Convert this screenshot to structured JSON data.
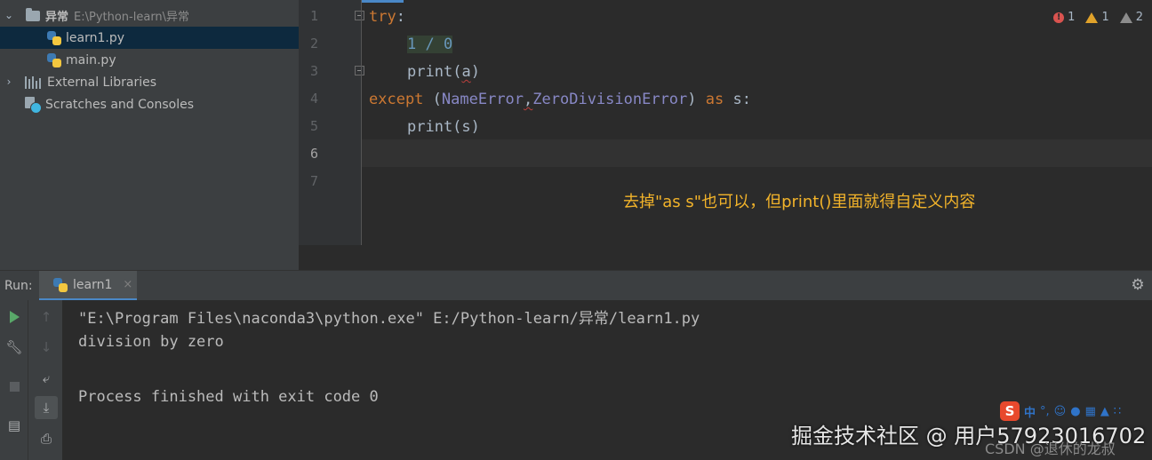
{
  "project_tree": {
    "root_name": "异常",
    "root_path": "E:\\Python-learn\\异常",
    "files": [
      "learn1.py",
      "main.py"
    ],
    "external_libraries": "External Libraries",
    "scratches": "Scratches and Consoles"
  },
  "editor": {
    "line_numbers": [
      "1",
      "2",
      "3",
      "4",
      "5",
      "6",
      "7"
    ],
    "inspections": {
      "errors": "1",
      "warnings": "1",
      "weak_warnings": "2"
    },
    "code": {
      "try": "try",
      "colon": ":",
      "expr": "1 / 0",
      "print_a": "print",
      "print_a_arg_open": "(",
      "print_a_arg": "a",
      "print_a_arg_close": ")",
      "except": "except",
      "paren_open": " (",
      "name_error": "NameError",
      "comma": ",",
      "zero_div": "ZeroDivisionError",
      "paren_close": ") ",
      "as": "as",
      "alias": " s:",
      "print_s": "print(s)"
    },
    "annotation": "去掉\"as s\"也可以，但print()里面就得自定义内容"
  },
  "run_panel": {
    "label": "Run:",
    "tab": "learn1",
    "console": [
      "\"E:\\Program Files\\naconda3\\python.exe\" E:/Python-learn/异常/learn1.py",
      "division by zero",
      "",
      "Process finished with exit code 0"
    ]
  },
  "ime_toolbar": {
    "logo": "S",
    "mode": "中",
    "punct": "°,"
  },
  "watermark": "掘金技术社区 @ 用户57923016702",
  "csdn_watermark": "CSDN @退休的龙叔",
  "colors": {
    "keyword": "#cc7832",
    "number": "#6897bb",
    "builtin_class": "#8888c6",
    "annotation": "#f2b32a",
    "selection": "#0d293e"
  }
}
